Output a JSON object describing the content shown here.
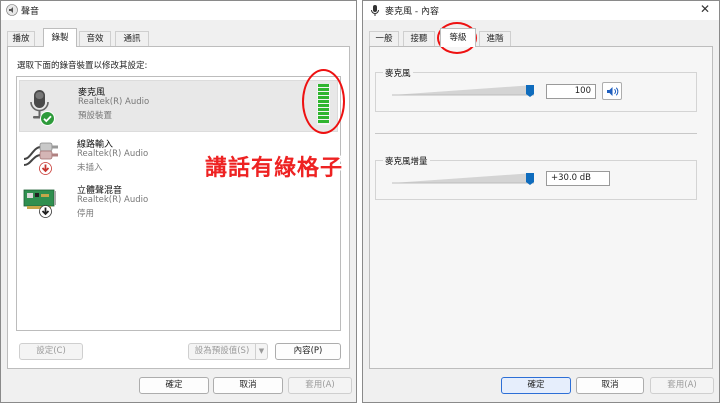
{
  "left_window": {
    "title": "聲音",
    "tabs": [
      "播放",
      "錄製",
      "音效",
      "通訊"
    ],
    "active_tab": 1,
    "instruction": "選取下面的錄音裝置以修改其設定:",
    "devices": [
      {
        "name": "麥克風",
        "driver": "Realtek(R) Audio",
        "status": "預設裝置",
        "status_icon": "check-icon"
      },
      {
        "name": "線路輸入",
        "driver": "Realtek(R) Audio",
        "status": "未插入",
        "status_icon": "down-arrow-icon"
      },
      {
        "name": "立體聲混音",
        "driver": "Realtek(R) Audio",
        "status": "停用",
        "status_icon": "down-arrow-icon"
      }
    ],
    "level_meter": {
      "level": 1.0,
      "color": "#2fb52f"
    },
    "buttons": {
      "configure": "設定(C)",
      "set_default": "設為預設值(S)",
      "properties": "內容(P)",
      "ok": "確定",
      "cancel": "取消",
      "apply": "套用(A)"
    }
  },
  "right_window": {
    "title": "麥克風 - 內容",
    "tabs": [
      "一般",
      "接聽",
      "等級",
      "進階"
    ],
    "active_tab": 2,
    "microphone": {
      "label": "麥克風",
      "value": "100",
      "level": 1.0
    },
    "boost": {
      "label": "麥克風增量",
      "value": "+30.0 dB",
      "level": 1.0
    },
    "buttons": {
      "ok": "確定",
      "cancel": "取消",
      "apply": "套用(A)"
    }
  },
  "annotation": {
    "text": "講話有綠格子",
    "color": "#ee2222"
  }
}
